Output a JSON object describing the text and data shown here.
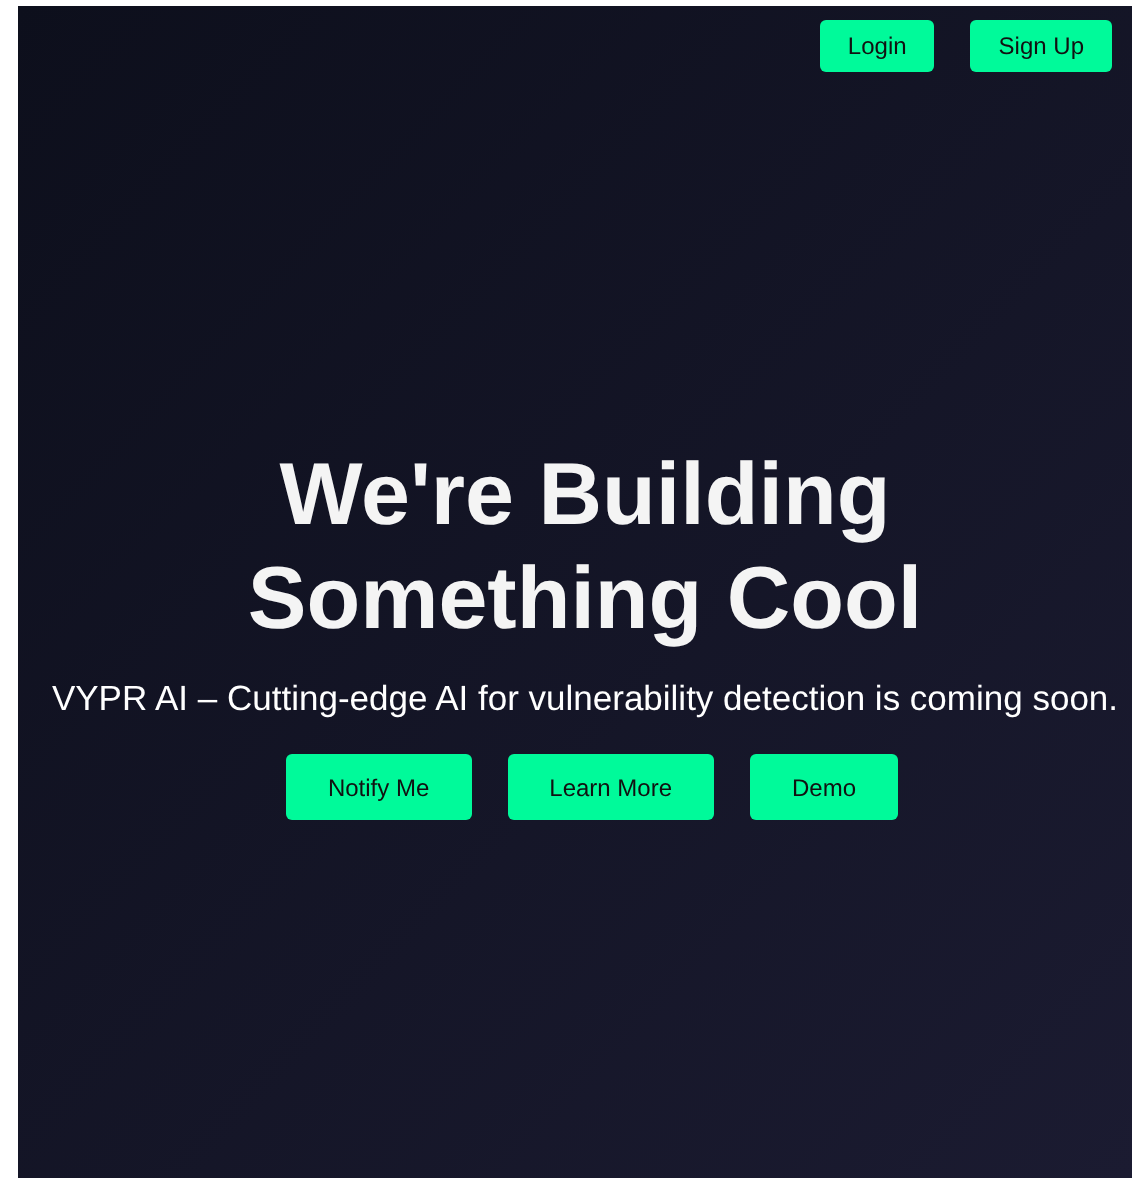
{
  "header": {
    "buttons": [
      "Login",
      "Sign Up"
    ]
  },
  "hero": {
    "title_lines": [
      "We're Building",
      "Something Cool"
    ],
    "subtitle": "VYPR AI – Cutting-edge AI for vulnerability detection is coming soon.",
    "buttons": [
      "Notify Me",
      "Learn More",
      "Demo"
    ]
  }
}
